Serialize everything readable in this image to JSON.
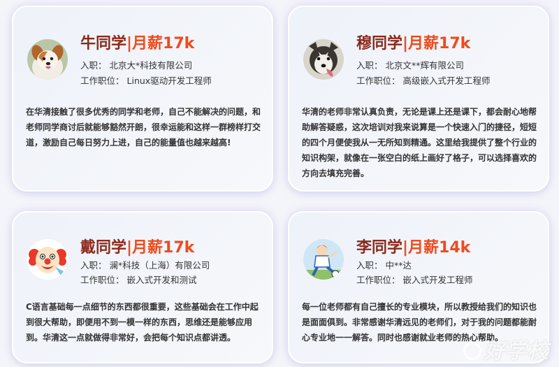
{
  "cards": [
    {
      "student": "牛同学",
      "salary": "|月薪17k",
      "company_label": "入职：",
      "company": "北京大*科技有限公司",
      "position_label": "工作职位：",
      "position": "Linux驱动开发工程师",
      "avatar_icon": "puppy-avatar-icon",
      "quote": "在华清接触了很多优秀的同学和老师，自己不能解决的问题，和老师同学商讨后就能够豁然开朗，很幸运能和这样一群榜样打交道，激励自己每日努力上进，自己的能量值也越来越高!"
    },
    {
      "student": "穆同学",
      "salary": "|月薪17k",
      "company_label": "入职：",
      "company": "北京文**辉有限公司",
      "position_label": "工作职位：",
      "position": "高级嵌入式开发工程师",
      "avatar_icon": "husky-avatar-icon",
      "quote": "华清的老师非常认真负责，无论是课上还是课下，都会耐心地帮助解答疑惑，这次培训对我来说算是一个快速入门的捷径，短短的四个月便使我从一无所知到精通。这里给我提供了整个行业的知识构架，就像在一张空白的纸上画好了格子，可以选择喜欢的方向去填充完善。"
    },
    {
      "student": "戴同学",
      "salary": "|月薪17k",
      "company_label": "入职：",
      "company": "澜*科技（上海）有限公司",
      "position_label": "工作职位：",
      "position": "嵌入式开发和测试",
      "avatar_icon": "clown-avatar-icon",
      "quote": "C语言基础每一点细节的东西都很重要，这些基础会在工作中起到很大帮助，即便用不到一模一样的东西，思维还是能够应用到。华清这一点就做得非常好，会把每个知识点都讲透。"
    },
    {
      "student": "李同学",
      "salary": "|月薪14k",
      "company_label": "入职：",
      "company": "中**达",
      "position_label": "工作职位：",
      "position": "嵌入式开发工程师",
      "avatar_icon": "soccer-player-avatar-icon",
      "quote": "每一位老师都有自己擅长的专业模块，所以教授给我们的知识也是面面俱到。非常感谢华清远见的老师们，对于我的问题都能耐心专业地一一解答。同时也感谢就业老师的热心帮助。"
    }
  ],
  "watermark": "好学校",
  "colors": {
    "student_name": "#8a2a1c",
    "salary": "#f04a1c",
    "card_background": "#eef2f9",
    "page_background": "#f4f5fa"
  }
}
